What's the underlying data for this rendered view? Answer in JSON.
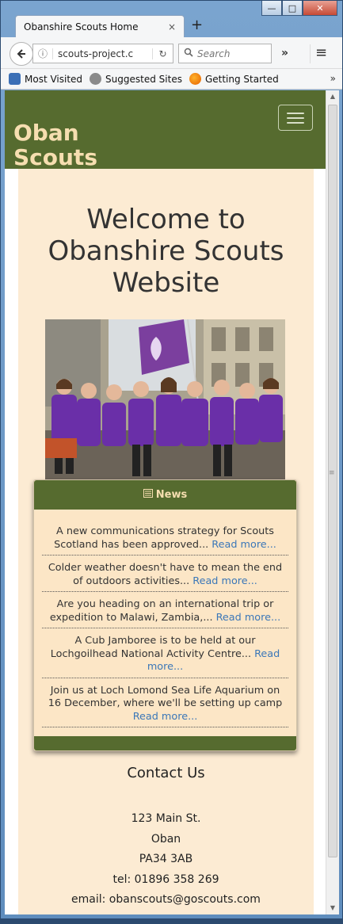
{
  "browser": {
    "tab_title": "Obanshire Scouts Home",
    "tab_close": "×",
    "new_tab": "+",
    "url": "scouts-project.c",
    "search_placeholder": "Search",
    "window_buttons": {
      "minimize": "—",
      "maximize": "□",
      "close": "✕"
    },
    "bookmarks": [
      {
        "label": "Most Visited",
        "icon": "most-visited-icon",
        "color": "#3b6fb6"
      },
      {
        "label": "Suggested Sites",
        "icon": "globe-icon",
        "color": "#8a8a8a"
      },
      {
        "label": "Getting Started",
        "icon": "firefox-icon",
        "color": "#e66000"
      }
    ]
  },
  "page": {
    "brand": "Oban Scouts",
    "heading": "Welcome to Obanshire Scouts Website",
    "news": {
      "title": "News",
      "icon": "newspaper-icon",
      "items": [
        {
          "text": "A new communications strategy for Scouts Scotland has been approved... ",
          "link": "Read more..."
        },
        {
          "text": "Colder weather doesn't have to mean the end of outdoors activities... ",
          "link": "Read more..."
        },
        {
          "text": "Are you heading on an international trip or expedition to Malawi, Zambia,... ",
          "link": "Read more..."
        },
        {
          "text": "A Cub Jamboree is to be held at our Lochgoilhead National Activity Centre... ",
          "link": "Read more..."
        },
        {
          "text": "Join us at Loch Lomond Sea Life Aquarium on 16 December, where we'll be setting up camp ",
          "link": "Read more..."
        }
      ]
    },
    "contact": {
      "title": "Contact Us",
      "lines": [
        "123 Main St.",
        "Oban",
        "PA34 3AB",
        "tel: 01896 358 269",
        "email: obanscouts@goscouts.com"
      ]
    }
  },
  "colors": {
    "nav": "#566b2f",
    "brand_text": "#f6deb0",
    "content_bg": "#fcebd3",
    "link": "#3b77b8"
  }
}
